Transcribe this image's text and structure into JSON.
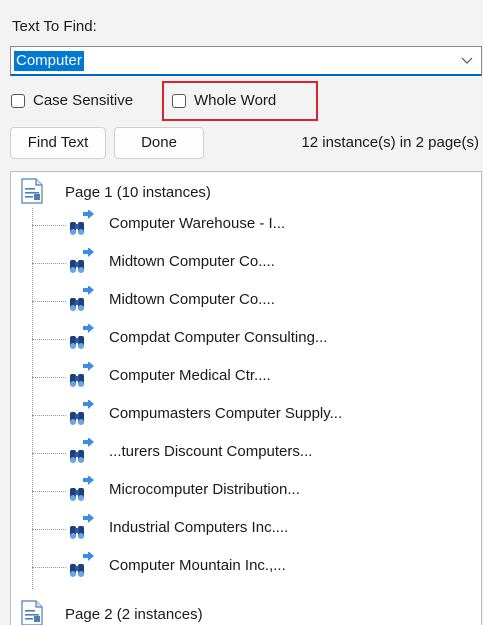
{
  "find": {
    "label": "Text To Find:",
    "value": "Computer"
  },
  "options": {
    "case_sensitive": "Case Sensitive",
    "whole_word": "Whole Word"
  },
  "buttons": {
    "find_text": "Find Text",
    "done": "Done"
  },
  "status": "12 instance(s) in 2 page(s)",
  "tree": {
    "pages": [
      {
        "label": "Page 1 (10 instances)",
        "items": [
          "Computer Warehouse - I...",
          "Midtown Computer Co....",
          "Midtown Computer Co....",
          "Compdat Computer Consulting...",
          "Computer Medical Ctr....",
          "Compumasters Computer Supply...",
          "...turers Discount Computers...",
          "Microcomputer Distribution...",
          "Industrial Computers Inc....",
          "Computer Mountain Inc.,..."
        ]
      },
      {
        "label": "Page 2 (2 instances)",
        "items": []
      }
    ]
  },
  "colors": {
    "selection": "#0078d4",
    "highlight_box": "#d9232e",
    "focus_underline": "#0067c0"
  }
}
